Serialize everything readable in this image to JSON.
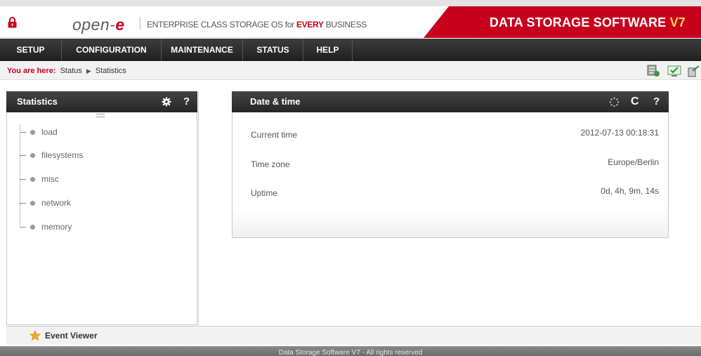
{
  "brand": {
    "logo_text": "open-",
    "logo_e": "e",
    "tagline_prefix": "ENTERPRISE CLASS STORAGE OS for ",
    "tagline_highlight": "EVERY",
    "tagline_suffix": " BUSINESS",
    "product_title": "DATA STORAGE SOFTWARE ",
    "product_version": "V7"
  },
  "nav": {
    "items": [
      {
        "label": "SETUP"
      },
      {
        "label": "CONFIGURATION"
      },
      {
        "label": "MAINTENANCE"
      },
      {
        "label": "STATUS"
      },
      {
        "label": "HELP"
      }
    ]
  },
  "breadcrumb": {
    "prefix": "You are here:",
    "items": [
      "Status",
      "Statistics"
    ]
  },
  "statistics_panel": {
    "title": "Statistics",
    "settings_icon": "gear-icon",
    "help_label": "?",
    "items": [
      {
        "label": "load"
      },
      {
        "label": "filesystems"
      },
      {
        "label": "misc"
      },
      {
        "label": "network"
      },
      {
        "label": "memory"
      }
    ]
  },
  "datetime_panel": {
    "title": "Date & time",
    "refresh_label": "C",
    "help_label": "?",
    "rows": [
      {
        "label": "Current time",
        "value": "2012-07-13 00:18:31"
      },
      {
        "label": "Time zone",
        "value": "Europe/Berlin"
      },
      {
        "label": "Uptime",
        "value": "0d, 4h, 9m, 14s"
      }
    ]
  },
  "event_viewer": {
    "label": "Event Viewer"
  },
  "footer": {
    "text": "Data Storage Software V7 - All rights reserved"
  },
  "colors": {
    "brand_red": "#c8001e",
    "nav_dark": "#2a2a2a",
    "version_yellow": "#ffd54a"
  }
}
